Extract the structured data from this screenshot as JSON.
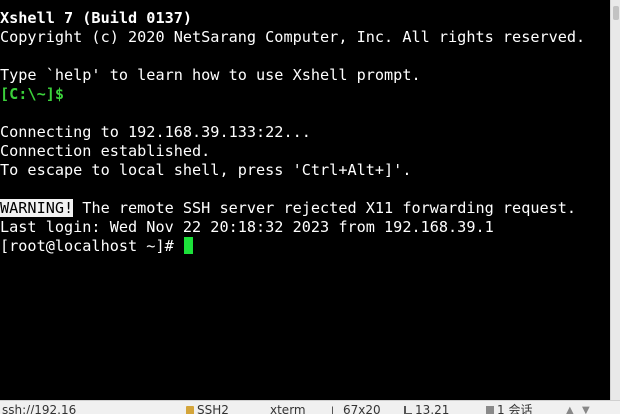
{
  "terminal": {
    "header_line1": "Xshell 7 (Build 0137)",
    "header_line2": "Copyright (c) 2020 NetSarang Computer, Inc. All rights reserved.",
    "help_line": "Type `help' to learn how to use Xshell prompt.",
    "local_prompt": "[C:\\~]$",
    "connecting": "Connecting to 192.168.39.133:22...",
    "established": "Connection established.",
    "escape_hint": "To escape to local shell, press 'Ctrl+Alt+]'.",
    "warning_label": "WARNING!",
    "warning_text": " The remote SSH server rejected X11 forwarding request.",
    "last_login": "Last login: Wed Nov 22 20:18:32 2023 from 192.168.39.1",
    "remote_prompt": "[root@localhost ~]# "
  },
  "statusbar": {
    "session": "ssh://192.16",
    "protocol": "SSH2",
    "terminal_type": "xterm",
    "size": "67x20",
    "cursor_pos": "13,21",
    "sessions": "1 会话"
  },
  "colors": {
    "background": "#000000",
    "text": "#ffffff",
    "prompt_green": "#3bd13b",
    "cursor": "#1ce13a"
  }
}
